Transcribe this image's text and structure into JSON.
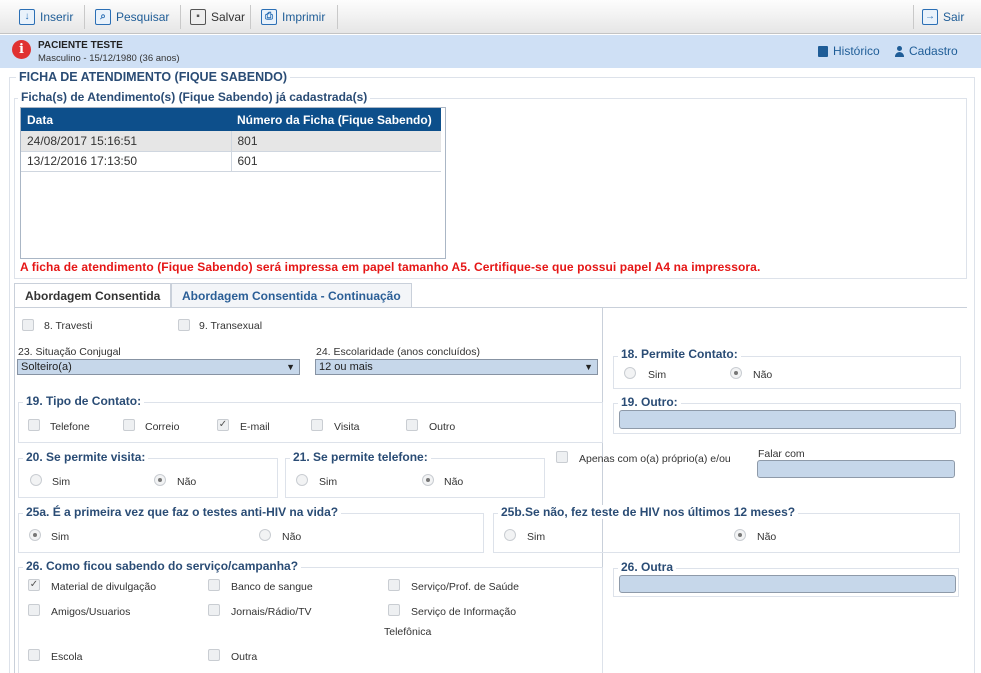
{
  "toolbar": {
    "inserir": "Inserir",
    "pesquisar": "Pesquisar",
    "salvar": "Salvar",
    "imprimir": "Imprimir",
    "sair": "Sair"
  },
  "patient": {
    "name": "PACIENTE TESTE",
    "info": "Masculino - 15/12/1980 (36 anos)",
    "historico": "Histórico",
    "cadastro": "Cadastro"
  },
  "main_title": "FICHA DE ATENDIMENTO (FIQUE SABENDO)",
  "list": {
    "legend": "Ficha(s) de Atendimento(s) (Fique Sabendo) já cadastrada(s)",
    "col_data": "Data",
    "col_numero": "Número da Ficha (Fique Sabendo)",
    "rows": [
      {
        "data": "24/08/2017 15:16:51",
        "numero": "801"
      },
      {
        "data": "13/12/2016 17:13:50",
        "numero": "601"
      }
    ]
  },
  "warning": "A ficha de atendimento (Fique Sabendo) será impressa em papel tamanho A5. Certifique-se que possui papel A4 na impressora.",
  "tabs": [
    "Abordagem Consentida",
    "Abordagem Consentida - Continuação"
  ],
  "form": {
    "travesti": "8. Travesti",
    "transexual": "9. Transexual",
    "q23_label": "23. Situação Conjugal",
    "q23_value": "Solteiro(a)",
    "q24_label": "24. Escolaridade (anos concluídos)",
    "q24_value": "12 ou mais",
    "q18_legend": "18. Permite Contato:",
    "sim": "Sim",
    "nao": "Não",
    "q19_legend": "19. Tipo de Contato:",
    "telefone": "Telefone",
    "correio": "Correio",
    "email": "E-mail",
    "visita": "Visita",
    "outro": "Outro",
    "q19_outro_legend": "19. Outro:",
    "q20_legend": "20. Se permite visita:",
    "q21_legend": "21. Se permite telefone:",
    "apenas": "Apenas com o(a) próprio(a) e/ou",
    "falar_com": "Falar com",
    "q25a_legend": "25a. É a primeira vez que faz o testes anti-HIV na vida?",
    "q25b_legend": "25b.Se não, fez teste de HIV nos últimos 12 meses?",
    "q26_legend": "26. Como ficou sabendo do serviço/campanha?",
    "material": "Material de divulgação",
    "banco": "Banco de sangue",
    "servico_prof": "Serviço/Prof. de Saúde",
    "amigos": "Amigos/Usuarios",
    "jornais": "Jornais/Rádio/TV",
    "servico_info": "Serviço de Informação",
    "telefonica": "Telefônica",
    "escola": "Escola",
    "outra": "Outra",
    "q26_outra_legend": "26. Outra"
  },
  "colors": {
    "accent": "#1f5d97",
    "header_bg": "#0d4f8b",
    "warning": "#e51616",
    "input_bg": "#c6d7ea"
  }
}
